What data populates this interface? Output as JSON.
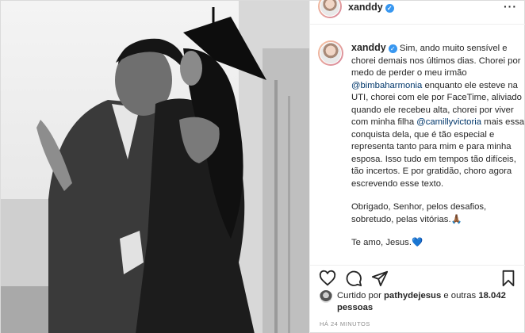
{
  "post": {
    "username": "xanddy",
    "caption_username": "xanddy",
    "caption": {
      "p1_a": "Sim, ando muito sensível e chorei demais nos últimos dias. Chorei por medo de perder o meu irmão ",
      "mention1": "@bimbaharmonia",
      "p1_b": " enquanto ele esteve na UTI, chorei com ele por FaceTime, aliviado quando ele recebeu alta, chorei por viver com minha filha ",
      "mention2": "@camillyvictoria",
      "p1_c": " mais essa conquista dela, que é tão especial e representa tanto para mim e para minha esposa. Isso tudo em tempos tão difíceis, tão incertos. E por gratidão, choro agora escrevendo esse texto.",
      "p2": "Obrigado, Senhor, pelos desafios, sobretudo, pelas vitórias.🙏🏾",
      "p3": "Te amo, Jesus.",
      "p3_emoji": "💙"
    },
    "liked_by_prefix": "Curtido por ",
    "liked_by_user": "pathydejesus",
    "liked_by_mid": " e outras ",
    "liked_by_count": "18.042 pessoas",
    "time": "HÁ 24 MINUTOS"
  },
  "icons": {
    "more": "more-options-icon",
    "like": "heart-icon",
    "comment": "comment-icon",
    "share": "share-icon",
    "save": "bookmark-icon",
    "verified": "verified-badge-icon"
  },
  "colors": {
    "verified": "#3897f0",
    "mention": "#00376b",
    "muted": "#8e8e8e"
  }
}
